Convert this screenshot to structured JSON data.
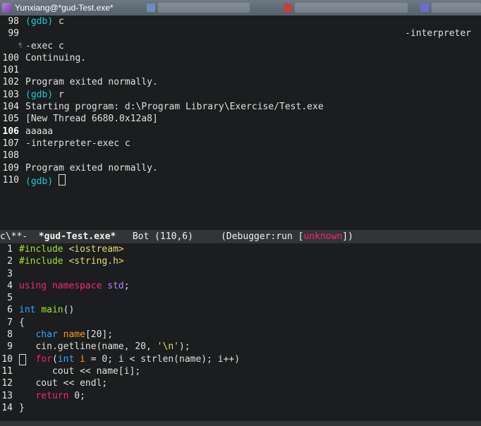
{
  "window": {
    "title": "Yunxiang@*gud-Test.exe*"
  },
  "gdb": {
    "lines": [
      {
        "n": "98",
        "parts": [
          {
            "t": "(gdb)",
            "c": "prompt"
          },
          {
            "t": " c",
            "c": ""
          }
        ]
      },
      {
        "n": "99",
        "right": "-interpreter"
      },
      {
        "n": "",
        "parts": [
          {
            "t": "-exec c",
            "c": ""
          }
        ],
        "fringe": "¶"
      },
      {
        "n": "100",
        "parts": [
          {
            "t": "Continuing.",
            "c": ""
          }
        ]
      },
      {
        "n": "101",
        "parts": []
      },
      {
        "n": "102",
        "parts": [
          {
            "t": "Program exited normally.",
            "c": ""
          }
        ]
      },
      {
        "n": "103",
        "parts": [
          {
            "t": "(gdb)",
            "c": "prompt"
          },
          {
            "t": " r",
            "c": ""
          }
        ]
      },
      {
        "n": "104",
        "parts": [
          {
            "t": "Starting program: d:\\Program Library\\Exercise/Test.exe",
            "c": ""
          }
        ]
      },
      {
        "n": "105",
        "parts": [
          {
            "t": "[New Thread 6680.0x12a8]",
            "c": ""
          }
        ]
      },
      {
        "n": "106",
        "cur": true,
        "parts": [
          {
            "t": "aaaaa",
            "c": ""
          }
        ]
      },
      {
        "n": "107",
        "parts": [
          {
            "t": "-interpreter-exec c",
            "c": ""
          }
        ]
      },
      {
        "n": "108",
        "parts": []
      },
      {
        "n": "109",
        "parts": [
          {
            "t": "Program exited normally.",
            "c": ""
          }
        ]
      },
      {
        "n": "110",
        "parts": [
          {
            "t": "(gdb)",
            "c": "prompt"
          },
          {
            "t": " ",
            "c": ""
          }
        ],
        "cursor": true
      }
    ]
  },
  "modeline": {
    "state": "c\\**-  ",
    "buffer": "*gud-Test.exe*",
    "position": "   Bot (110,6)     (Debugger:run [",
    "status": "unknown",
    "end": "])"
  },
  "source": {
    "lines": [
      {
        "n": "1",
        "parts": [
          {
            "t": "#include ",
            "c": "pp"
          },
          {
            "t": "<iostream>",
            "c": "inc"
          }
        ]
      },
      {
        "n": "2",
        "parts": [
          {
            "t": "#include ",
            "c": "pp"
          },
          {
            "t": "<string.h>",
            "c": "inc"
          }
        ]
      },
      {
        "n": "3",
        "parts": []
      },
      {
        "n": "4",
        "parts": [
          {
            "t": "using",
            "c": "kw"
          },
          {
            "t": " ",
            "c": ""
          },
          {
            "t": "namespace",
            "c": "kw"
          },
          {
            "t": " ",
            "c": ""
          },
          {
            "t": "std",
            "c": "ns"
          },
          {
            "t": ";",
            "c": ""
          }
        ]
      },
      {
        "n": "5",
        "parts": []
      },
      {
        "n": "6",
        "parts": [
          {
            "t": "int",
            "c": "type"
          },
          {
            "t": " ",
            "c": ""
          },
          {
            "t": "main",
            "c": "fn"
          },
          {
            "t": "()",
            "c": ""
          }
        ]
      },
      {
        "n": "7",
        "parts": [
          {
            "t": "{",
            "c": ""
          }
        ]
      },
      {
        "n": "8",
        "parts": [
          {
            "t": "   ",
            "c": ""
          },
          {
            "t": "char",
            "c": "type"
          },
          {
            "t": " ",
            "c": ""
          },
          {
            "t": "name",
            "c": "var"
          },
          {
            "t": "[20];",
            "c": ""
          }
        ]
      },
      {
        "n": "9",
        "parts": [
          {
            "t": "   cin.getline(name, 20, ",
            "c": ""
          },
          {
            "t": "'\\n'",
            "c": "str"
          },
          {
            "t": ");",
            "c": ""
          }
        ]
      },
      {
        "n": "10",
        "cursor": true,
        "parts": [
          {
            "t": "   ",
            "c": ""
          },
          {
            "t": "for",
            "c": "kw"
          },
          {
            "t": "(",
            "c": ""
          },
          {
            "t": "int",
            "c": "type"
          },
          {
            "t": " ",
            "c": ""
          },
          {
            "t": "i",
            "c": "var"
          },
          {
            "t": " = 0; i < strlen(name); i++)",
            "c": ""
          }
        ]
      },
      {
        "n": "11",
        "parts": [
          {
            "t": "      cout << name[i];",
            "c": ""
          }
        ]
      },
      {
        "n": "12",
        "parts": [
          {
            "t": "   cout << endl;",
            "c": ""
          }
        ]
      },
      {
        "n": "13",
        "parts": [
          {
            "t": "   ",
            "c": ""
          },
          {
            "t": "return",
            "c": "kw"
          },
          {
            "t": " 0;",
            "c": ""
          }
        ]
      },
      {
        "n": "14",
        "parts": [
          {
            "t": "}",
            "c": ""
          }
        ]
      }
    ]
  }
}
